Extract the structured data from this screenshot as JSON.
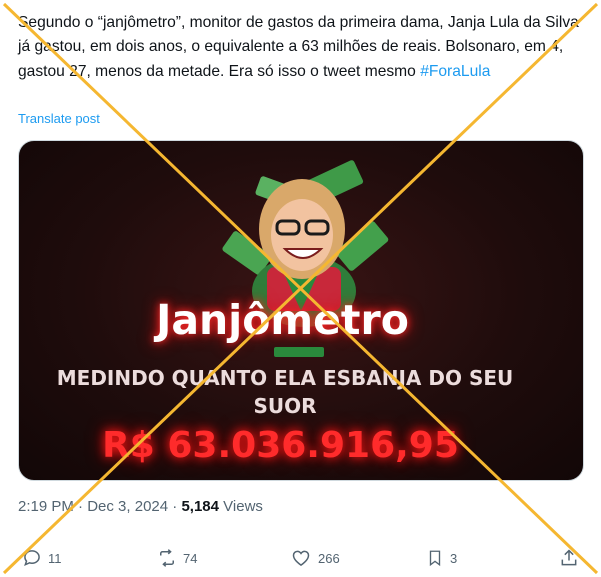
{
  "post": {
    "text_main": "Segundo o “janjômetro”, monitor de gastos da primeira dama, Janja Lula da Silva já gastou, em dois anos, o equivalente a 63 milhões de reais. Bolsonaro, em 4, gastou 27, menos da metade. Era só isso o tweet mesmo ",
    "hashtag": "#ForaLula",
    "translate_label": "Translate post"
  },
  "media": {
    "title": "Janjômetro",
    "subtitle": "MEDINDO QUANTO ELA ESBANJA DO SEU SUOR",
    "amount": "R$ 63.036.916,95",
    "accent_color": "#ff2b2b"
  },
  "meta": {
    "time": "2:19 PM",
    "separator1": " · ",
    "date": "Dec 3, 2024",
    "separator2": " · ",
    "views_count": "5,184",
    "views_label": " Views"
  },
  "actions": {
    "replies": "11",
    "reposts": "74",
    "likes": "266",
    "bookmarks": "3"
  },
  "overlay": {
    "mark": "cross",
    "color": "#f5b731"
  }
}
